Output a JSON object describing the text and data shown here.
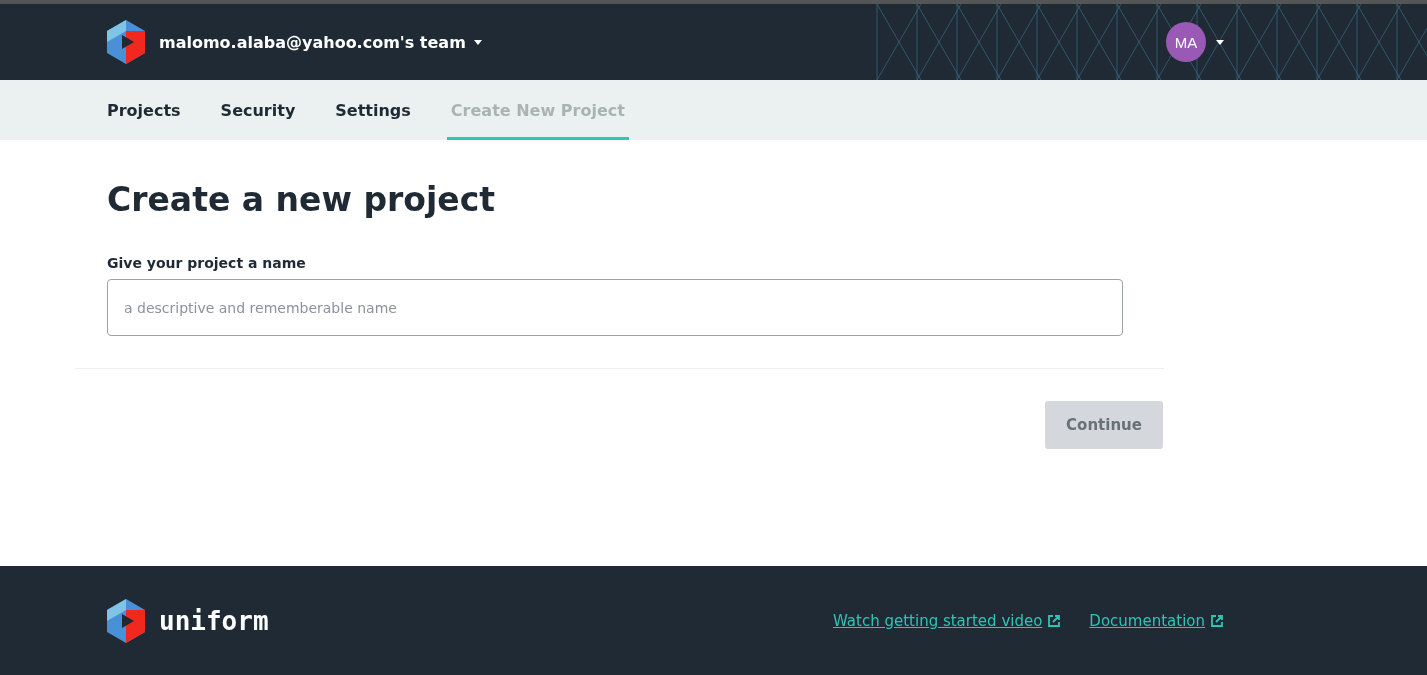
{
  "header": {
    "team": "malomo.alaba@yahoo.com's team",
    "avatar": {
      "initials": "MA",
      "color": "#9b59b6"
    }
  },
  "tabs": [
    {
      "label": "Projects",
      "selected": false
    },
    {
      "label": "Security",
      "selected": false
    },
    {
      "label": "Settings",
      "selected": false
    },
    {
      "label": "Create New Project",
      "selected": true
    }
  ],
  "page": {
    "title": "Create a new project",
    "field": {
      "label": "Give your project a name",
      "placeholder": "a descriptive and rememberable name"
    },
    "button": {
      "label": "Continue",
      "disabled": true
    }
  },
  "footer": {
    "brand": "uniform",
    "links": [
      {
        "label": "Watch getting started video"
      },
      {
        "label": "Documentation"
      }
    ]
  }
}
